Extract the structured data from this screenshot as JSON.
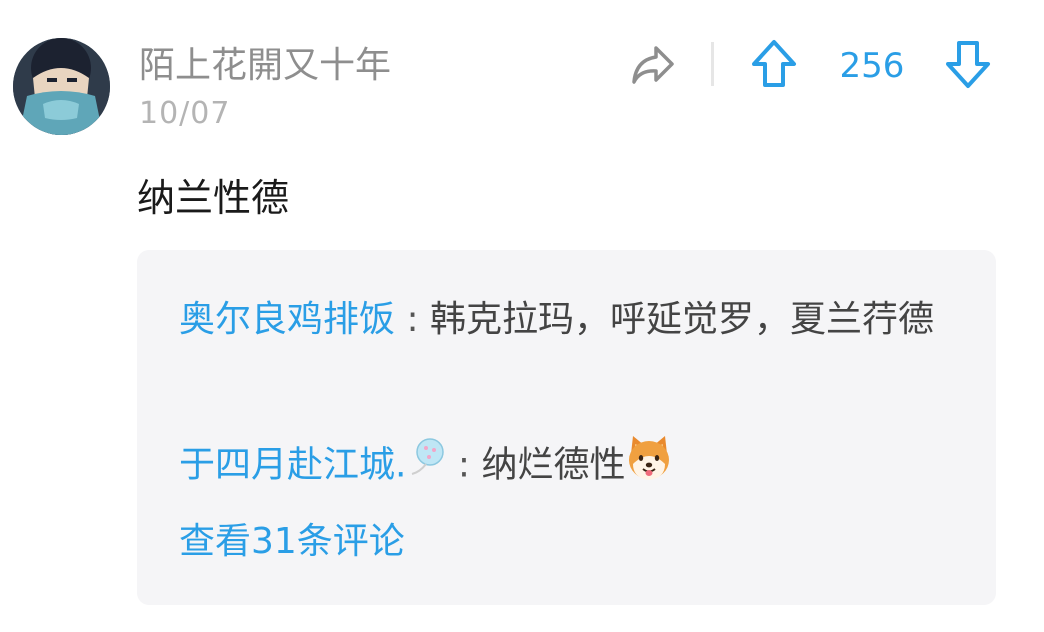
{
  "comment": {
    "username": "陌上花開又十年",
    "date": "10/07",
    "text": "纳兰性德",
    "votes": "256"
  },
  "replies": [
    {
      "author": "奥尔良鸡排饭",
      "separator": " : ",
      "text": "韩克拉玛，呼延觉罗，夏兰荇德"
    },
    {
      "author": "于四月赴江城.",
      "separator": " : ",
      "text": "纳烂德性"
    }
  ],
  "more_link": "查看31条评论",
  "icons": {
    "share": "share-arrow-icon",
    "upvote": "up-arrow-icon",
    "downvote": "down-arrow-icon",
    "reply2_author_badge": "balloon-icon",
    "reply2_emoji": "shiba-dog-emoji"
  },
  "colors": {
    "accent": "#2a9ee6",
    "username": "#8e8e8e",
    "date": "#b4b4b4",
    "reply_bg": "#f5f5f7"
  }
}
